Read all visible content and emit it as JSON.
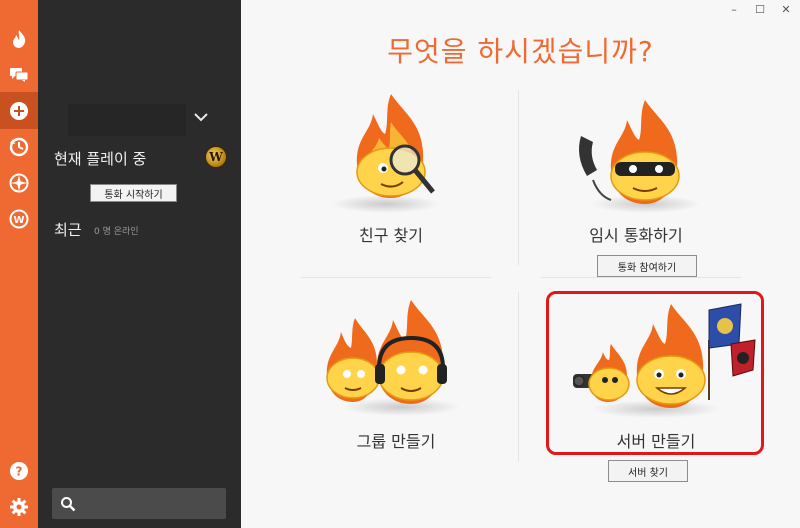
{
  "rail": {
    "items": [
      {
        "icon": "flame-logo-icon"
      },
      {
        "icon": "chat-icon"
      },
      {
        "icon": "add-icon"
      },
      {
        "icon": "refresh-icon"
      },
      {
        "icon": "compass-icon"
      },
      {
        "icon": "wow-game-icon"
      },
      {
        "icon": "help-icon"
      },
      {
        "icon": "settings-icon"
      }
    ]
  },
  "sidebar": {
    "now_playing": "현재 플레이 중",
    "wow_badge": "W",
    "start_call": "통화 시작하기",
    "recent": "최근",
    "recent_count": "0 명 온라인"
  },
  "main": {
    "title": "무엇을 하시겠습니까?",
    "tiles": {
      "find_friends": {
        "label": "친구 찾기"
      },
      "quick_call": {
        "label": "임시 통화하기",
        "button": "통화 참여하기"
      },
      "create_group": {
        "label": "그룹 만들기"
      },
      "create_server": {
        "label": "서버 만들기",
        "button": "서버 찾기"
      }
    }
  },
  "colors": {
    "accent": "#ef6a33",
    "rail_active": "#c9501f",
    "sidebar": "#2b2b2b",
    "highlight": "#e01818"
  }
}
